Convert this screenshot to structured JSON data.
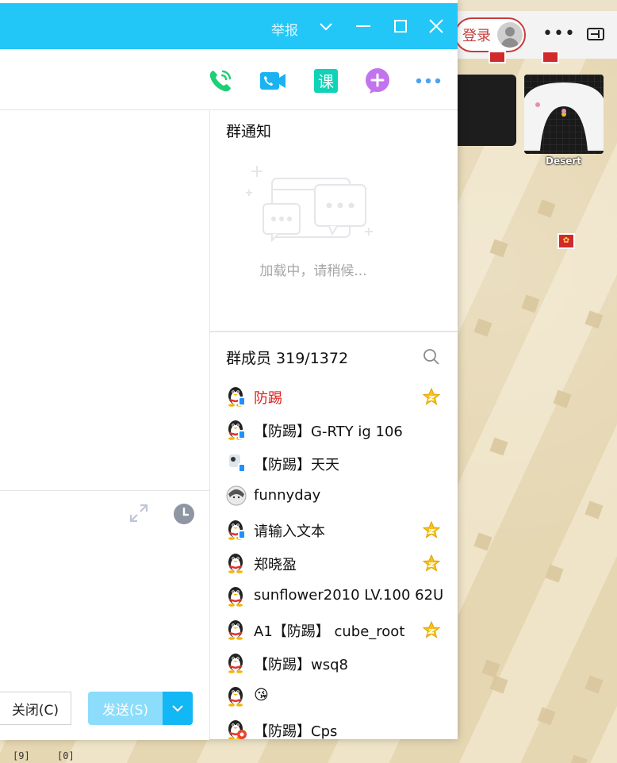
{
  "window": {
    "report_label": "举报",
    "close_label": "关闭(C)",
    "send_label": "发送(S)"
  },
  "notice": {
    "title": "群通知",
    "loading_text": "加载中，请稍候..."
  },
  "members": {
    "title": "群成员 319/1372",
    "list": [
      {
        "name": "防踢",
        "highlight": true,
        "star": true,
        "avatar": "penguin-badge-icon"
      },
      {
        "name": "【防踢】G-RTY ig 106",
        "highlight": false,
        "star": false,
        "avatar": "penguin-badge-icon"
      },
      {
        "name": "【防踢】天天",
        "highlight": false,
        "star": false,
        "avatar": "custom-avatar-icon"
      },
      {
        "name": "funnyday",
        "highlight": false,
        "star": false,
        "avatar": "photo-avatar-icon"
      },
      {
        "name": "请输入文本",
        "highlight": false,
        "star": true,
        "avatar": "penguin-badge-icon"
      },
      {
        "name": "郑晓盈",
        "highlight": false,
        "star": true,
        "avatar": "penguin-icon"
      },
      {
        "name": "sunflower2010 LV.100 62U",
        "highlight": false,
        "star": false,
        "avatar": "penguin-icon"
      },
      {
        "name": "A1【防踢】 cube_root",
        "highlight": false,
        "star": true,
        "avatar": "penguin-icon"
      },
      {
        "name": "【防踢】wsq8",
        "highlight": false,
        "star": false,
        "avatar": "penguin-icon"
      },
      {
        "name": "😘",
        "highlight": false,
        "star": false,
        "avatar": "penguin-icon"
      },
      {
        "name": "【防踢】Cps",
        "highlight": false,
        "star": false,
        "avatar": "penguin-red-badge-icon"
      }
    ]
  },
  "background": {
    "login_label": "登录",
    "map_caption": "Desert",
    "bottom_labels": [
      "[9]",
      "[0]"
    ]
  },
  "colors": {
    "titlebar": "#22c7f8",
    "send_disabled": "#8cdcfb",
    "send_arrow": "#12b7f5",
    "highlight_name": "#e0201c"
  }
}
